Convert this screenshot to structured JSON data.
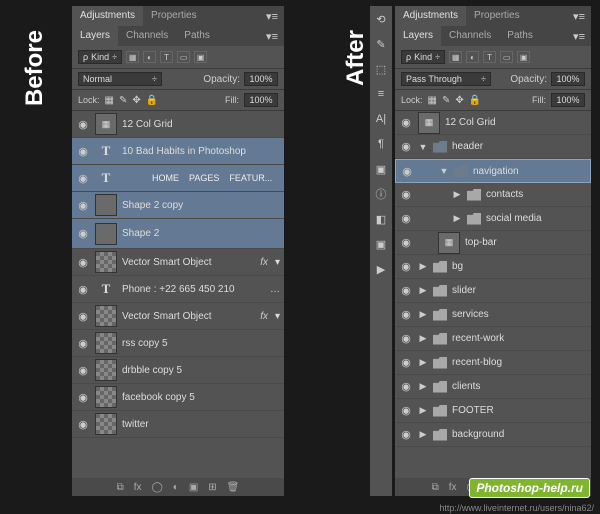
{
  "labels": {
    "before": "Before",
    "after": "After"
  },
  "tabs": {
    "adjustments": "Adjustments",
    "properties": "Properties",
    "layers": "Layers",
    "channels": "Channels",
    "paths": "Paths"
  },
  "filter": {
    "kind": "Kind"
  },
  "blend": {
    "normal": "Normal",
    "passthrough": "Pass Through",
    "opacity_label": "Opacity:",
    "opacity_val": "100%"
  },
  "lock": {
    "label": "Lock:",
    "fill_label": "Fill:",
    "fill_val": "100%"
  },
  "left_layers": [
    {
      "eye": true,
      "thumb": "grid",
      "name": "12 Col Grid"
    },
    {
      "eye": true,
      "thumb": "T",
      "name": "10 Bad Habits in Photoshop",
      "sel": true
    },
    {
      "eye": true,
      "thumb": "T",
      "links": [
        "HOME",
        "PAGES",
        "FEATUR..."
      ],
      "sel": true
    },
    {
      "eye": true,
      "thumb": "shape",
      "name": "Shape 2 copy",
      "sel": true
    },
    {
      "eye": true,
      "thumb": "shape",
      "name": "Shape 2",
      "sel": true,
      "tall": true
    },
    {
      "eye": true,
      "thumb": "smart",
      "name": "Vector Smart Object",
      "fx": true
    },
    {
      "eye": true,
      "thumb": "T",
      "name": "Phone : +22 665 450 210",
      "dots": true
    },
    {
      "eye": true,
      "thumb": "smart",
      "name": "Vector Smart Object",
      "fx": true
    },
    {
      "eye": true,
      "thumb": "tr",
      "name": "rss copy 5"
    },
    {
      "eye": true,
      "thumb": "tr",
      "name": "drbble copy 5"
    },
    {
      "eye": true,
      "thumb": "tr",
      "name": "facebook copy 5"
    },
    {
      "eye": true,
      "thumb": "tr",
      "name": "twitter"
    }
  ],
  "right_layers": [
    {
      "eye": true,
      "thumb": "grid",
      "name": "12 Col Grid",
      "indent": 0
    },
    {
      "eye": true,
      "tw": "▼",
      "fold": "open",
      "name": "header",
      "indent": 0
    },
    {
      "eye": true,
      "tw": "▼",
      "fold": "open",
      "name": "navigation",
      "indent": 2,
      "sel": true
    },
    {
      "eye": true,
      "tw": "▶",
      "fold": "c",
      "name": "contacts",
      "indent": 3
    },
    {
      "eye": true,
      "tw": "▶",
      "fold": "c",
      "name": "social media",
      "indent": 3
    },
    {
      "eye": true,
      "thumb": "grid",
      "name": "top-bar",
      "indent": 2
    },
    {
      "eye": true,
      "tw": "▶",
      "fold": "c",
      "name": "bg",
      "indent": 0
    },
    {
      "eye": true,
      "tw": "▶",
      "fold": "c",
      "name": "slider",
      "indent": 0
    },
    {
      "eye": true,
      "tw": "▶",
      "fold": "c",
      "name": "services",
      "indent": 0
    },
    {
      "eye": true,
      "tw": "▶",
      "fold": "c",
      "name": "recent-work",
      "indent": 0
    },
    {
      "eye": true,
      "tw": "▶",
      "fold": "c",
      "name": "recent-blog",
      "indent": 0
    },
    {
      "eye": true,
      "tw": "▶",
      "fold": "c",
      "name": "clients",
      "indent": 0
    },
    {
      "eye": true,
      "tw": "▶",
      "fold": "c",
      "name": "FOOTER",
      "indent": 0
    },
    {
      "eye": true,
      "tw": "▶",
      "fold": "c",
      "name": "background",
      "indent": 0
    }
  ],
  "badge": "Photoshop-help.ru",
  "watermark": "http://www.liveinternet.ru/users/nina62/"
}
